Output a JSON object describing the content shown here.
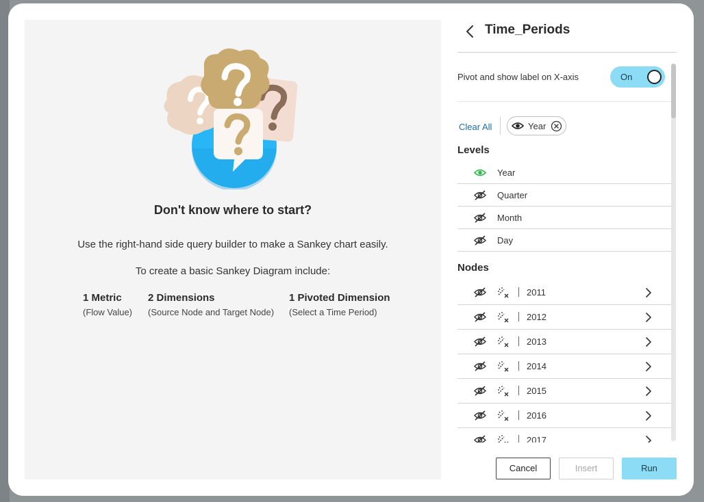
{
  "empty_state": {
    "title": "Don't know where to start?",
    "line1": "Use the right-hand side query builder to make a Sankey chart easily.",
    "line2": "To create a basic Sankey Diagram include:",
    "requirements": [
      {
        "title": "1 Metric",
        "subtitle": "(Flow Value)"
      },
      {
        "title": "2 Dimensions",
        "subtitle": "(Source Node and Target Node)"
      },
      {
        "title": "1 Pivoted Dimension",
        "subtitle": "(Select a Time Period)"
      }
    ]
  },
  "panel": {
    "title": "Time_Periods",
    "pivot_label": "Pivot and show label on X-axis",
    "toggle_state": "On",
    "clear_all": "Clear All",
    "chip_label": "Year",
    "levels_title": "Levels",
    "levels": [
      {
        "label": "Year",
        "visible": true
      },
      {
        "label": "Quarter",
        "visible": false
      },
      {
        "label": "Month",
        "visible": false
      },
      {
        "label": "Day",
        "visible": false
      }
    ],
    "nodes_title": "Nodes",
    "nodes": [
      "2011",
      "2012",
      "2013",
      "2014",
      "2015",
      "2016",
      "2017"
    ]
  },
  "footer": {
    "cancel": "Cancel",
    "insert": "Insert",
    "run": "Run"
  },
  "colors": {
    "accent": "#8ddcf5",
    "link": "#1d6fa5",
    "visible_eye": "#2db84b",
    "illustration_circle": "#29b6f6"
  },
  "icons": {
    "back": "chevron-left-icon",
    "visible": "eye-icon",
    "hidden": "eye-off-icon",
    "edit": "edit-clear-icon",
    "expand": "chevron-right-icon",
    "remove": "close-circle-icon"
  }
}
